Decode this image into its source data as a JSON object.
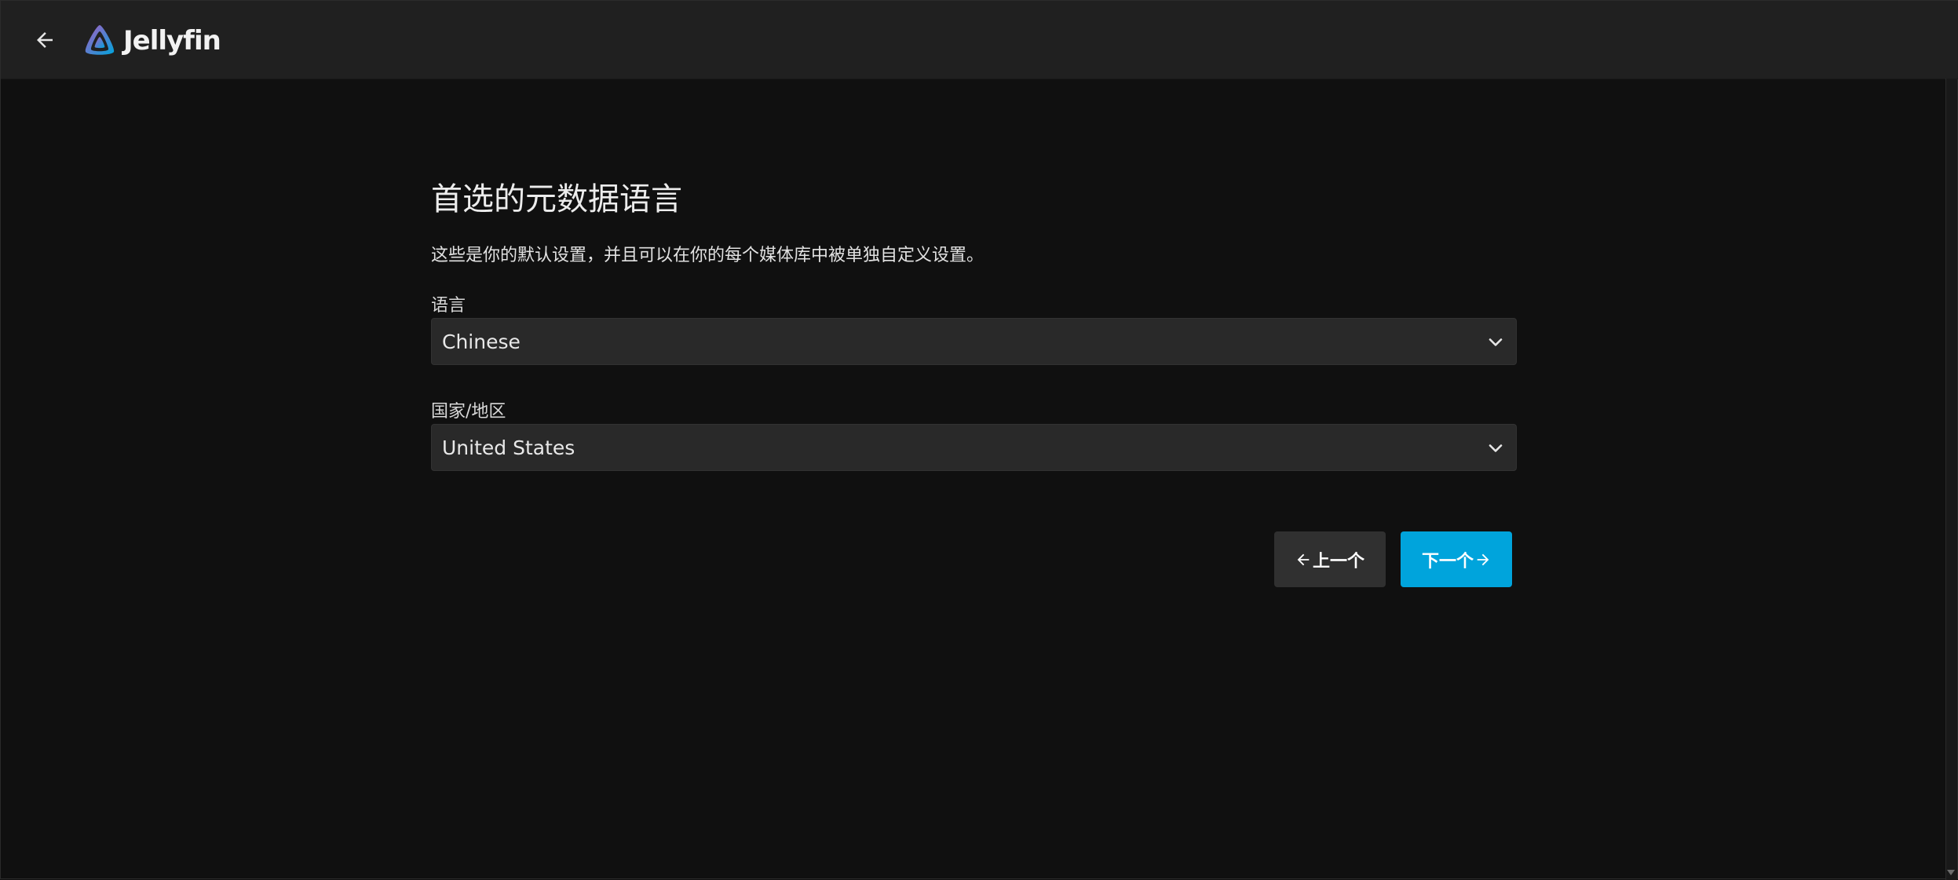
{
  "header": {
    "back_icon": "arrow-left-icon",
    "logo_icon": "jellyfin-logo-icon",
    "logo_text": "Jellyfin"
  },
  "page": {
    "title": "首选的元数据语言",
    "subtitle": "这些是你的默认设置，并且可以在你的每个媒体库中被单独自定义设置。"
  },
  "fields": {
    "language": {
      "label": "语言",
      "value": "Chinese",
      "icon": "chevron-down-icon"
    },
    "country": {
      "label": "国家/地区",
      "value": "United States",
      "icon": "chevron-down-icon"
    }
  },
  "buttons": {
    "prev_label": "上一个",
    "prev_icon": "arrow-left-icon",
    "next_label": "下一个",
    "next_icon": "arrow-right-icon"
  },
  "colors": {
    "accent": "#00a4dc",
    "background": "#101010",
    "header": "#202020",
    "input": "#292929",
    "secondary_button": "#303030"
  }
}
